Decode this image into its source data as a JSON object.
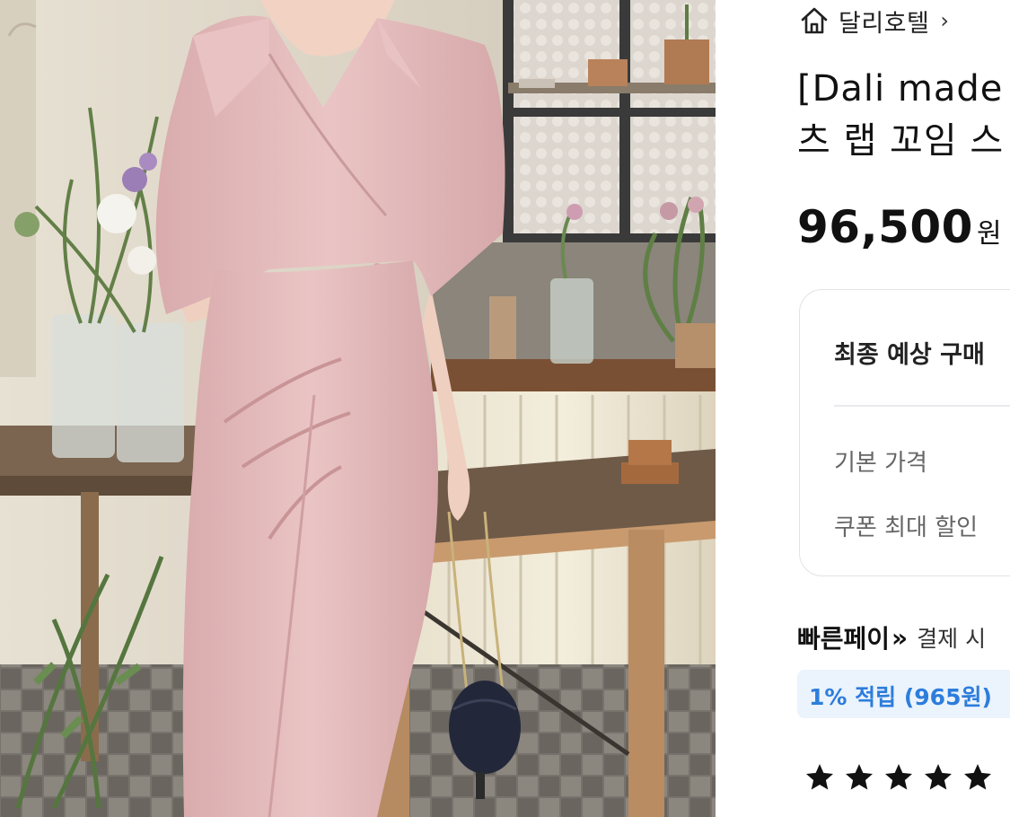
{
  "product_image": {
    "alt": ""
  },
  "breadcrumb": {
    "home_icon": "home-icon",
    "label": "달리호텔",
    "arrow": "›"
  },
  "product": {
    "title_line1": "[Dali made",
    "title_line2": "츠 랩 꼬임 스"
  },
  "price": {
    "amount": "96,500",
    "unit": "원"
  },
  "final_price_box": {
    "title": "최종 예상 구매",
    "base_price_label": "기본 가격",
    "coupon_label": "쿠폰 최대 할인"
  },
  "fast_pay": {
    "brand": "빠른페이",
    "arrow": "»",
    "text": "결제 시"
  },
  "reward_badge": {
    "text": "1% 적립 (965원)"
  },
  "rating": {
    "stars": 5,
    "max": 5,
    "icon": "star-icon"
  },
  "colors": {
    "accent_blue": "#2d7ddb",
    "badge_bg": "#ebf3fd",
    "dress_pink": "#e2b9ba"
  }
}
